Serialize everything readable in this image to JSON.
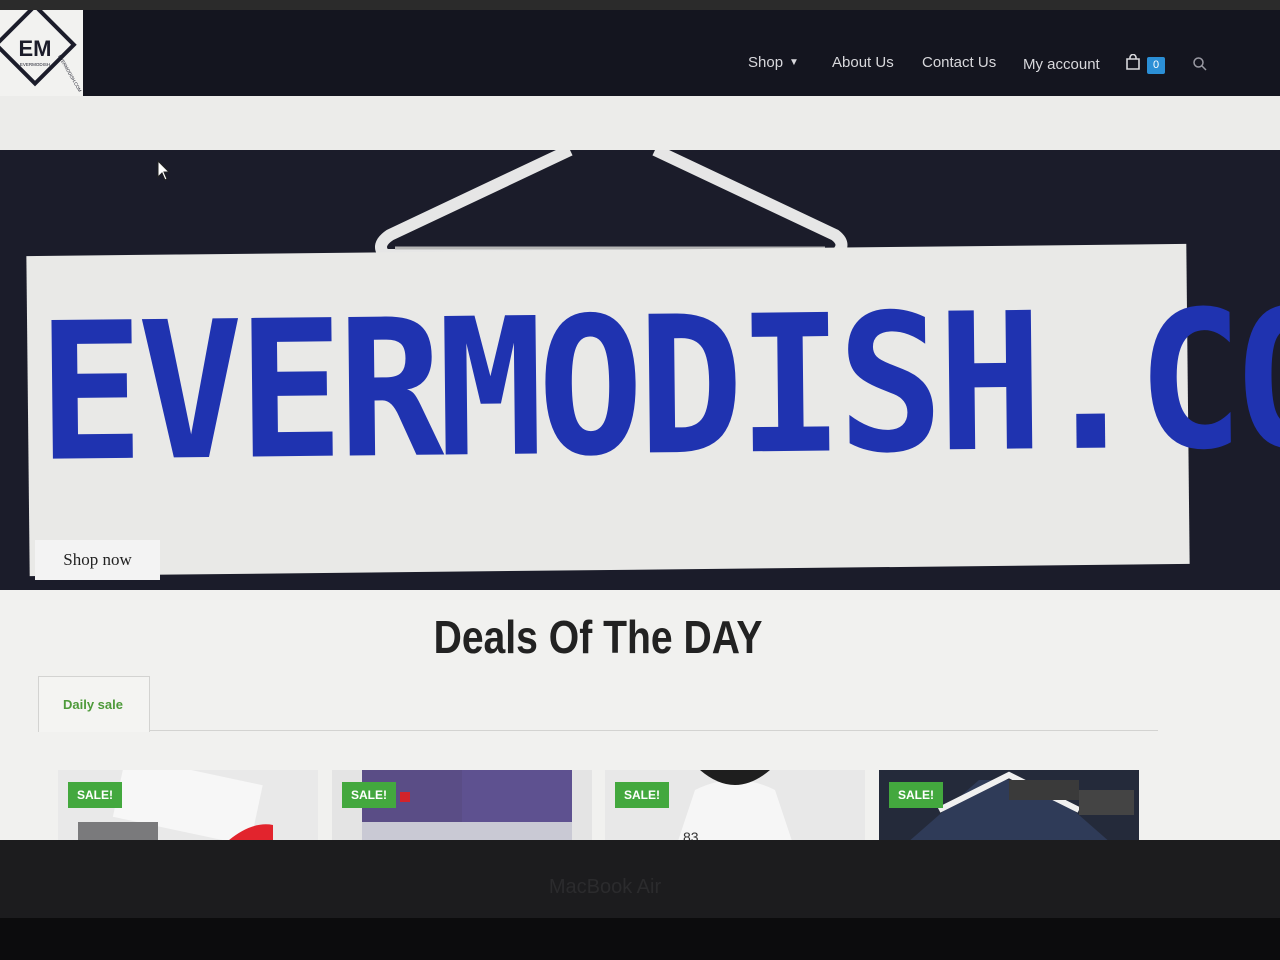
{
  "logo": {
    "mark": "EM",
    "sub": "EVERMODISH",
    "site": "EVERMODISH.COM"
  },
  "nav": {
    "items": [
      {
        "label": "Shop",
        "has_dropdown": true
      },
      {
        "label": "About Us"
      },
      {
        "label": "Contact Us"
      },
      {
        "label": "My account"
      }
    ],
    "cart_count": "0",
    "icons": {
      "cart": "shopping-bag-icon",
      "search": "search-icon",
      "dropdown": "chevron-down-icon"
    }
  },
  "hero": {
    "sign_text": "EVERMODISH.COM",
    "button": "Shop now",
    "colors": {
      "sign_text": "#1f33b0",
      "background": "#1b1c2a"
    }
  },
  "deals": {
    "title": "Deals Of The DAY",
    "tab": "Daily sale",
    "products": [
      {
        "badge": "SALE!"
      },
      {
        "badge": "SALE!"
      },
      {
        "badge": "SALE!"
      },
      {
        "badge": "SALE!"
      }
    ]
  },
  "device": {
    "label": "MacBook Air"
  },
  "colors": {
    "nav": "#14151f",
    "sale_badge": "#43a83e",
    "tab_text": "#4d9a3a",
    "cart_badge": "#2b8fd6"
  }
}
